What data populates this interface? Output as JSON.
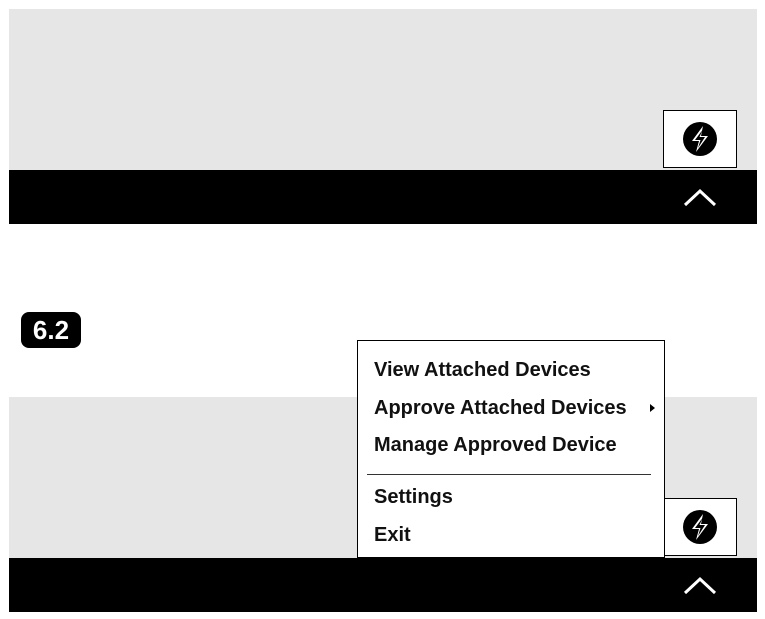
{
  "step_badge": "6.2",
  "tray_icon": "thunderbolt-icon",
  "taskbar_icon": "chevron-up-icon",
  "context_menu": {
    "items": [
      {
        "label": "View Attached Devices"
      },
      {
        "label": "Approve Attached Devices",
        "has_submenu": true
      },
      {
        "label": "Manage Approved Device"
      },
      {
        "label": "Settings"
      },
      {
        "label": "Exit"
      }
    ]
  },
  "colors": {
    "desktop": "#e6e6e7",
    "taskbar": "#000000",
    "badge": "#000000"
  }
}
